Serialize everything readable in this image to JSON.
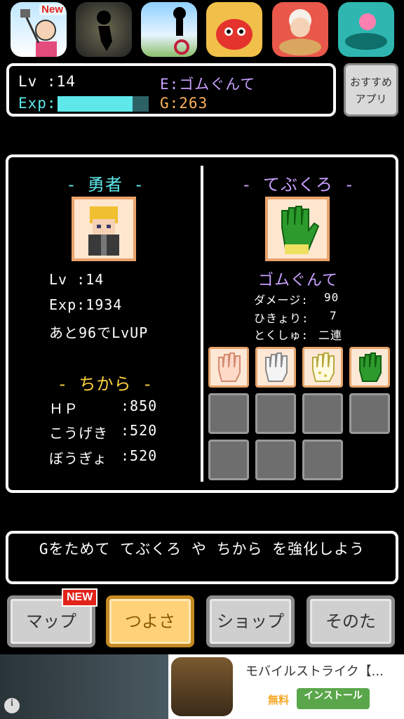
{
  "apps": [
    {
      "name": "selfie-app",
      "badge": "New"
    },
    {
      "name": "shadow-runner-app",
      "badge": ""
    },
    {
      "name": "unicycle-app",
      "badge": ""
    },
    {
      "name": "dragon-puzzle-app",
      "badge": ""
    },
    {
      "name": "grandma-app",
      "badge": ""
    },
    {
      "name": "ball-app",
      "badge": ""
    }
  ],
  "status": {
    "lv_label": "Lv :14",
    "exp_label": "Exp:",
    "exp_fraction": 0.82,
    "equip_label": "E:ゴムぐんて",
    "gold_label": "G:263"
  },
  "recommend_button": [
    "おすすめ",
    "アプリ"
  ],
  "hero": {
    "title": "- 勇者 -",
    "lv": "Lv :14",
    "exp": "Exp:1934",
    "next": "あと96でLvUP",
    "power_title": "- ちから -",
    "stats": [
      {
        "label": "ＨＰ",
        "value": ":850"
      },
      {
        "label": "こうげき",
        "value": ":520"
      },
      {
        "label": "ぼうぎょ",
        "value": ":520"
      }
    ]
  },
  "gloves": {
    "title": "- てぶくろ -",
    "name": "ゴムぐんて",
    "damage_label": "ダメージ:",
    "damage_value": "90",
    "flinch_label": "ひきょり:",
    "flinch_value": "7",
    "special_label": "とくしゅ:",
    "special_value": "二連",
    "slots": [
      "bare-hand",
      "white-glove",
      "dotted-glove",
      "rubber-glove",
      "empty",
      "empty",
      "empty",
      "empty",
      "empty",
      "empty",
      "empty"
    ]
  },
  "message": "Gをためて てぶくろ や ちから を強化しよう",
  "nav": {
    "map": "マップ",
    "map_badge": "NEW",
    "strength": "つよさ",
    "shop": "ショップ",
    "other": "そのた"
  },
  "ad": {
    "title": "モバイルストライク【...",
    "price": "無料",
    "install": "インストール"
  }
}
